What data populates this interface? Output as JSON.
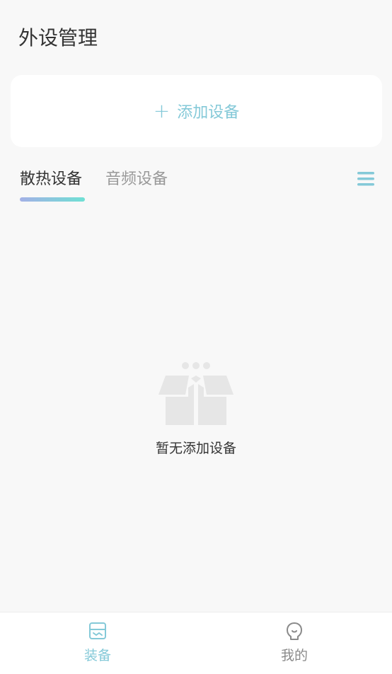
{
  "header": {
    "title": "外设管理"
  },
  "add_card": {
    "icon": "plus-icon",
    "label": "添加设备"
  },
  "tabs": [
    {
      "label": "散热设备",
      "active": true
    },
    {
      "label": "音频设备",
      "active": false
    }
  ],
  "menu": {
    "icon": "menu-icon"
  },
  "empty_state": {
    "icon": "empty-box-icon",
    "text": "暂无添加设备"
  },
  "bottom_nav": [
    {
      "label": "装备",
      "icon": "equipment-icon",
      "active": true
    },
    {
      "label": "我的",
      "icon": "profile-icon",
      "active": false
    }
  ],
  "colors": {
    "accent": "#84c9d8",
    "background": "#f8f8f8",
    "card": "#ffffff",
    "tab_gradient_start": "#a3b0e6",
    "tab_gradient_end": "#6fe0d4",
    "text_primary": "#333333",
    "text_secondary": "#999999"
  }
}
